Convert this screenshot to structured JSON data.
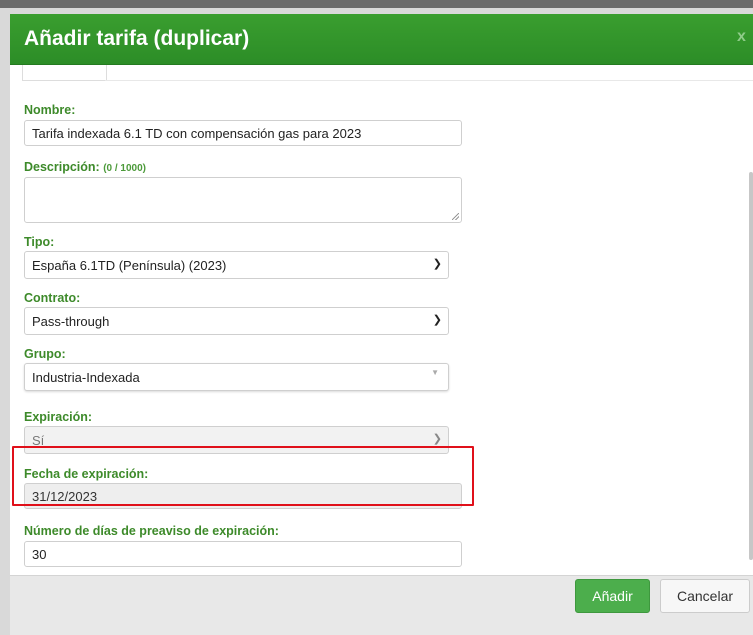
{
  "dialog": {
    "title": "Añadir tarifa (duplicar)",
    "close_label": "x"
  },
  "form": {
    "nombre": {
      "label": "Nombre:",
      "value": "Tarifa indexada 6.1 TD con compensación gas para 2023"
    },
    "descripcion": {
      "label": "Descripción:",
      "counter": "(0 / 1000)",
      "value": ""
    },
    "tipo": {
      "label": "Tipo:",
      "value": "España 6.1TD (Península) (2023)"
    },
    "contrato": {
      "label": "Contrato:",
      "value": "Pass-through"
    },
    "grupo": {
      "label": "Grupo:",
      "value": "Industria-Indexada"
    },
    "expiracion": {
      "label": "Expiración:",
      "value": "Sí",
      "disabled": true
    },
    "fecha_expiracion": {
      "label": "Fecha de expiración:",
      "value": "31/12/2023",
      "disabled": true
    },
    "dias_preaviso": {
      "label": "Número de días de preaviso de expiración:",
      "value": "30"
    }
  },
  "footer": {
    "add_label": "Añadir",
    "cancel_label": "Cancelar"
  },
  "colors": {
    "header_green": "#2c8d27",
    "label_green": "#3d8a2a",
    "add_button": "#4cae4c",
    "highlight_red": "#e0101a"
  },
  "icons": {
    "select_arrow": "chevron-down-icon",
    "combo_arrow": "triangle-down-icon",
    "resize": "resize-grip-icon"
  }
}
